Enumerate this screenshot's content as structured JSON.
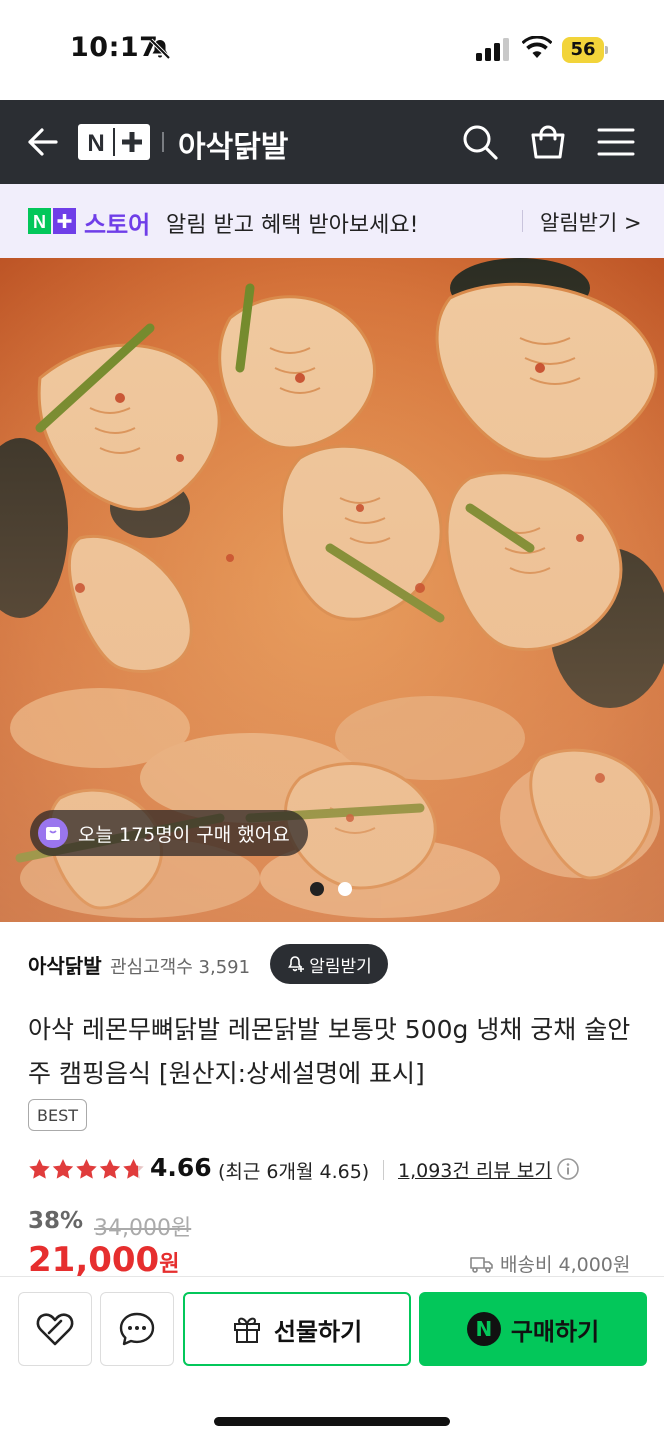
{
  "status_bar": {
    "time": "10:17",
    "battery": "56",
    "icons": [
      "bell-off-icon",
      "signal-icon",
      "wifi-icon",
      "battery-icon"
    ]
  },
  "header": {
    "logo_text": "N+",
    "store_name": "아삭닭발",
    "icons": [
      "back-arrow-icon",
      "search-icon",
      "cart-icon",
      "menu-icon"
    ]
  },
  "notify_banner": {
    "brand": "스토어",
    "message": "알림 받고 혜택 받아보세요!",
    "button": "알림받기 >"
  },
  "gallery": {
    "buy_count": "오늘 175명이 구매 했어요",
    "slide_count": 2,
    "active_slide": 1
  },
  "store": {
    "name": "아삭닭발",
    "followers": "관심고객수 3,591",
    "alarm_button": "알림받기"
  },
  "product": {
    "title": "아삭 레몬무뼈닭발 레몬닭발 보통맛 500g 냉채 궁채 술안주 캠핑음식 [원산지:상세설명에 표시]",
    "badge": "BEST",
    "rating": "4.66",
    "rating_recent": "(최근 6개월 4.65)",
    "review_link": "1,093건 리뷰 보기",
    "star_fill": 4.66,
    "discount": "38%",
    "original_price": "34,000원",
    "price": "21,000",
    "price_unit": "원",
    "shipping": "배송비 4,000원"
  },
  "bottom_bar": {
    "gift_label": "선물하기",
    "buy_label": "구매하기",
    "buy_icon_text": "N"
  },
  "colors": {
    "header_bg": "#2b2e33",
    "naver_green": "#03c75a",
    "store_purple": "#6f3ee8",
    "price_red": "#e62e2e",
    "star_red": "#e03c3c"
  }
}
